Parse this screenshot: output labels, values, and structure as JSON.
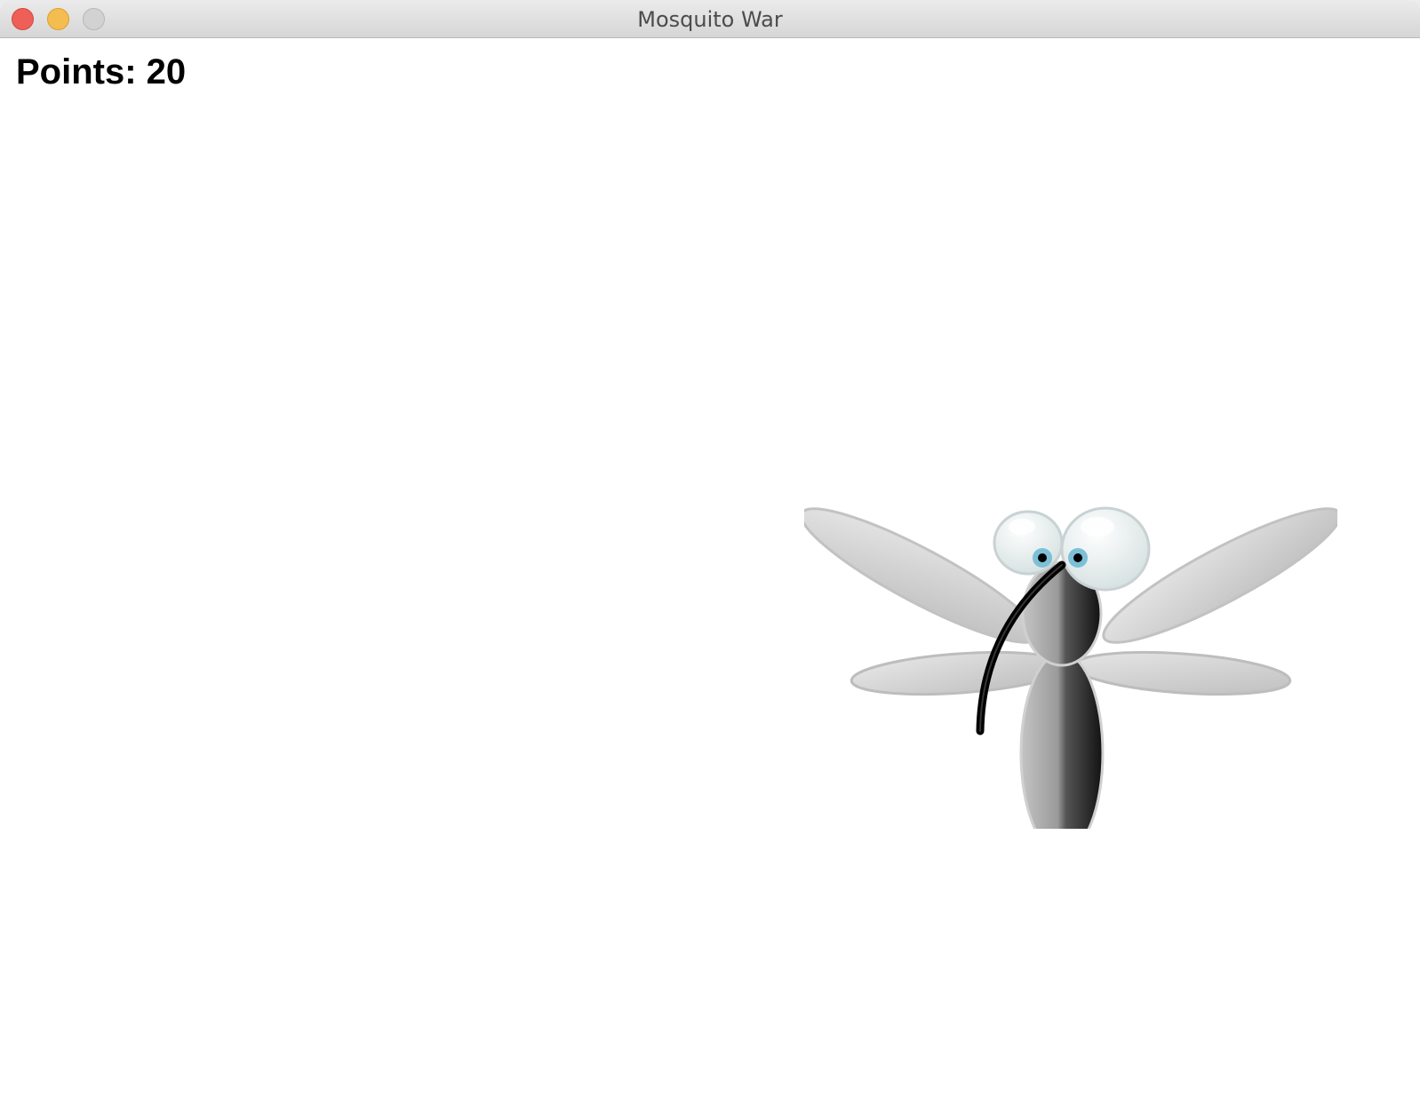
{
  "window": {
    "title": "Mosquito War",
    "controls": {
      "close": "close",
      "minimize": "minimize",
      "zoom": "zoom"
    }
  },
  "hud": {
    "points_label": "Points:",
    "points_value": "20"
  },
  "sprite": {
    "name": "mosquito",
    "colors": {
      "wing": "#d4d4d4",
      "body_light": "#b5b5b5",
      "body_dark": "#2a2a2a",
      "eye": "#e6eeee",
      "iris": "#7cc0d8",
      "proboscis": "#000000"
    }
  }
}
